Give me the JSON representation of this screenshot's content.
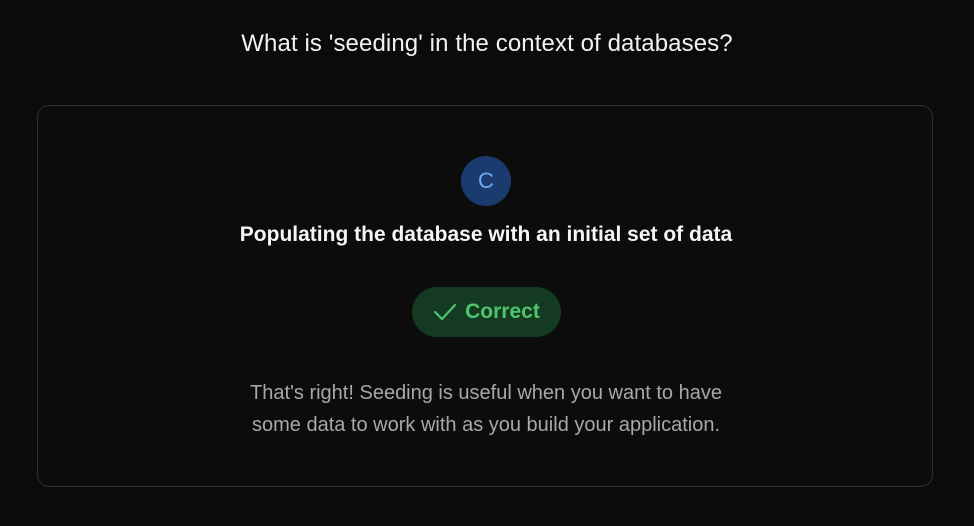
{
  "question": {
    "text": "What is 'seeding' in the context of databases?"
  },
  "answer_card": {
    "choice_letter": "C",
    "answer_text": "Populating the database with an initial set of data",
    "result": {
      "label": "Correct",
      "icon": "check-icon",
      "color": "#4fc46f"
    },
    "explanation_lines": [
      "That's right! Seeding is useful when you want to have",
      "some data to work with as you build your application."
    ]
  },
  "colors": {
    "background": "#0b0b0b",
    "badge_bg": "#1b3a6e",
    "badge_text": "#6ea8f5",
    "pill_bg": "#143a22"
  }
}
